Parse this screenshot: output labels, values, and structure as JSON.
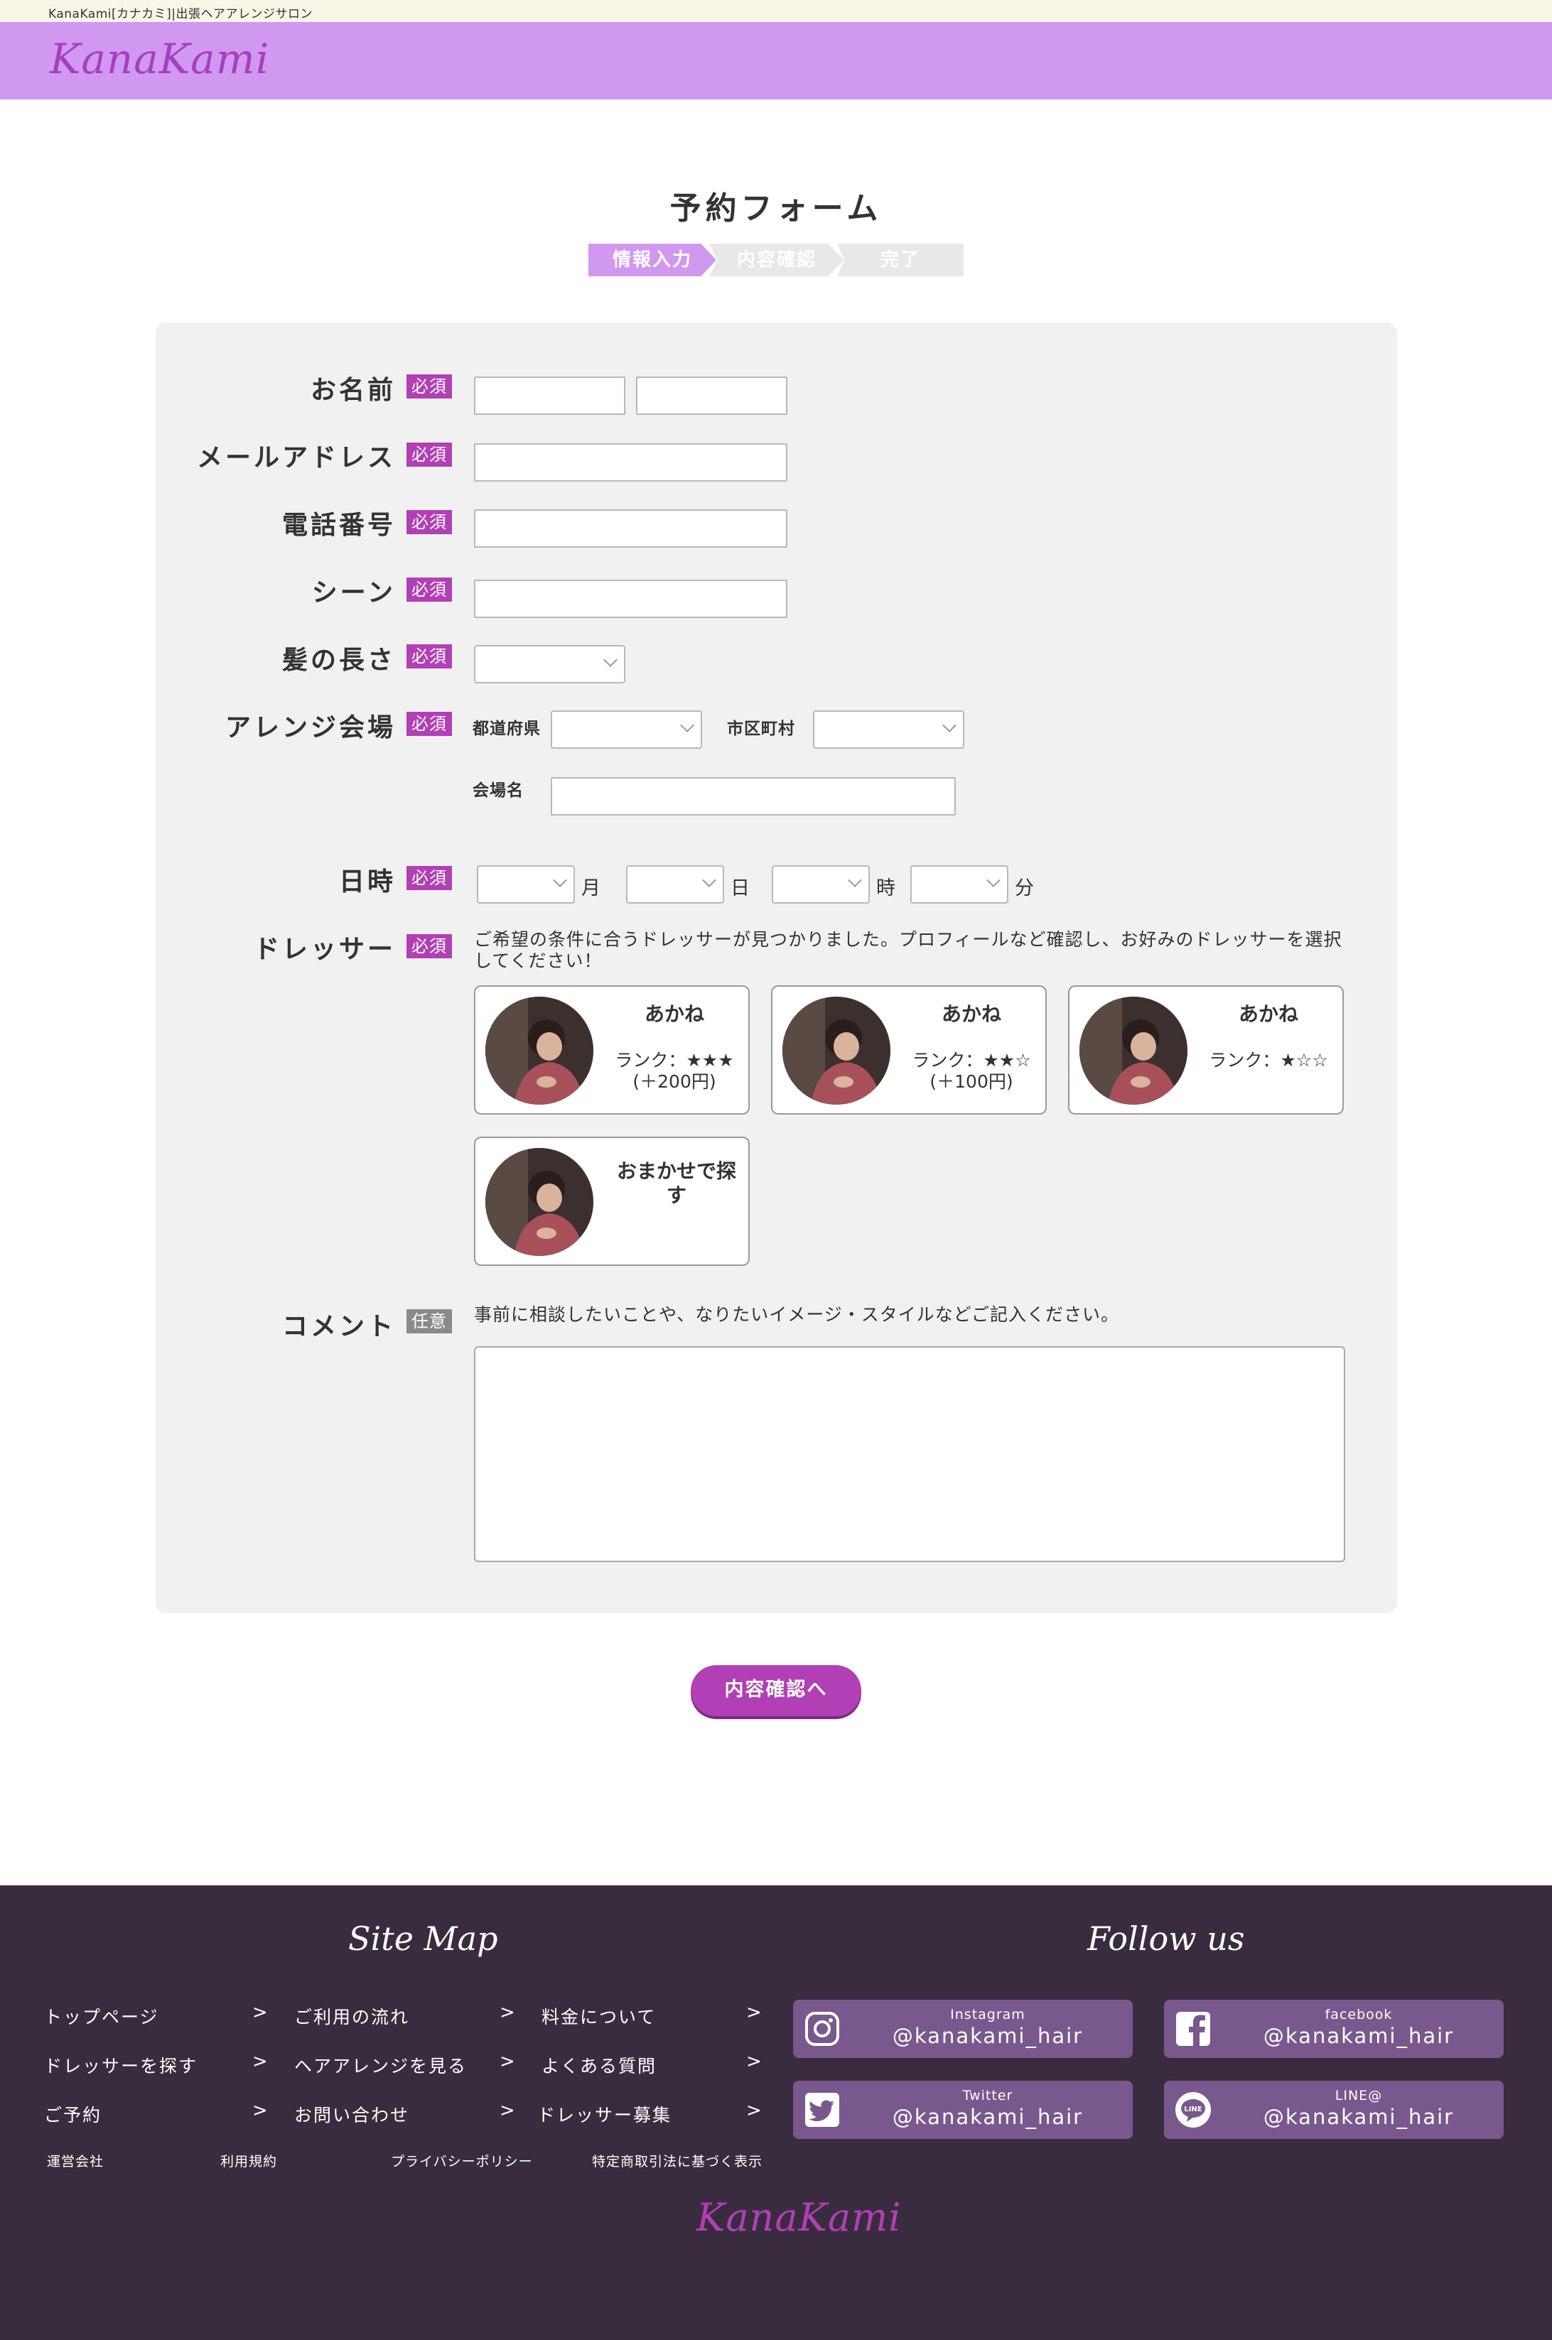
{
  "topbar": {
    "text": "KanaKami[カナカミ]|出張ヘアアレンジサロン"
  },
  "header": {
    "logo": "KanaKami"
  },
  "page": {
    "title": "予約フォーム"
  },
  "steps": [
    "情報入力",
    "内容確認",
    "完了"
  ],
  "form": {
    "required_badge": "必須",
    "optional_badge": "任意",
    "name_label": "お名前",
    "email_label": "メールアドレス",
    "phone_label": "電話番号",
    "scene_label": "シーン",
    "hair_length_label": "髪の長さ",
    "venue_label": "アレンジ会場",
    "prefecture_label": "都道府県",
    "city_label": "市区町村",
    "venue_name_label": "会場名",
    "datetime_label": "日時",
    "month_unit": "月",
    "day_unit": "日",
    "hour_unit": "時",
    "minute_unit": "分",
    "dresser_label": "ドレッサー",
    "dresser_note": "ご希望の条件に合うドレッサーが見つかりました。プロフィールなど確認し、お好みのドレッサーを選択してください！",
    "comment_label": "コメント",
    "comment_note": "事前に相談したいことや、なりたいイメージ・スタイルなどご記入ください。",
    "submit_label": "内容確認へ"
  },
  "dressers": [
    {
      "name": "あかね",
      "rank": "ランク：★★★",
      "price": "(＋200円)"
    },
    {
      "name": "あかね",
      "rank": "ランク：★★☆",
      "price": "(＋100円)"
    },
    {
      "name": "あかね",
      "rank": "ランク：★☆☆",
      "price": ""
    },
    {
      "name": "おまかせで探す",
      "rank": "",
      "price": ""
    }
  ],
  "footer": {
    "sitemap_title": "Site Map",
    "follow_title": "Follow us",
    "links": [
      "トップページ",
      "ご利用の流れ",
      "料金について",
      "ドレッサーを探す",
      "ヘアアレンジを見る",
      "よくある質問",
      "ご予約",
      "お問い合わせ",
      "ドレッサー募集"
    ],
    "arrow": ">",
    "small_links": [
      "運営会社",
      "利用規約",
      "プライバシーポリシー",
      "特定商取引法に基づく表示"
    ],
    "social": [
      {
        "network": "Instagram",
        "handle": "@kanakami_hair",
        "icon": "instagram-icon"
      },
      {
        "network": "facebook",
        "handle": "@kanakami_hair",
        "icon": "facebook-icon"
      },
      {
        "network": "Twitter",
        "handle": "@kanakami_hair",
        "icon": "twitter-icon"
      },
      {
        "network": "LINE@",
        "handle": "@kanakami_hair",
        "icon": "line-icon"
      }
    ],
    "logo": "KanaKami"
  },
  "colors": {
    "header_bg": "#d198f0",
    "accent": "#b23fb5",
    "footer_bg": "#3a2c3f",
    "social_bg": "#79588e"
  }
}
